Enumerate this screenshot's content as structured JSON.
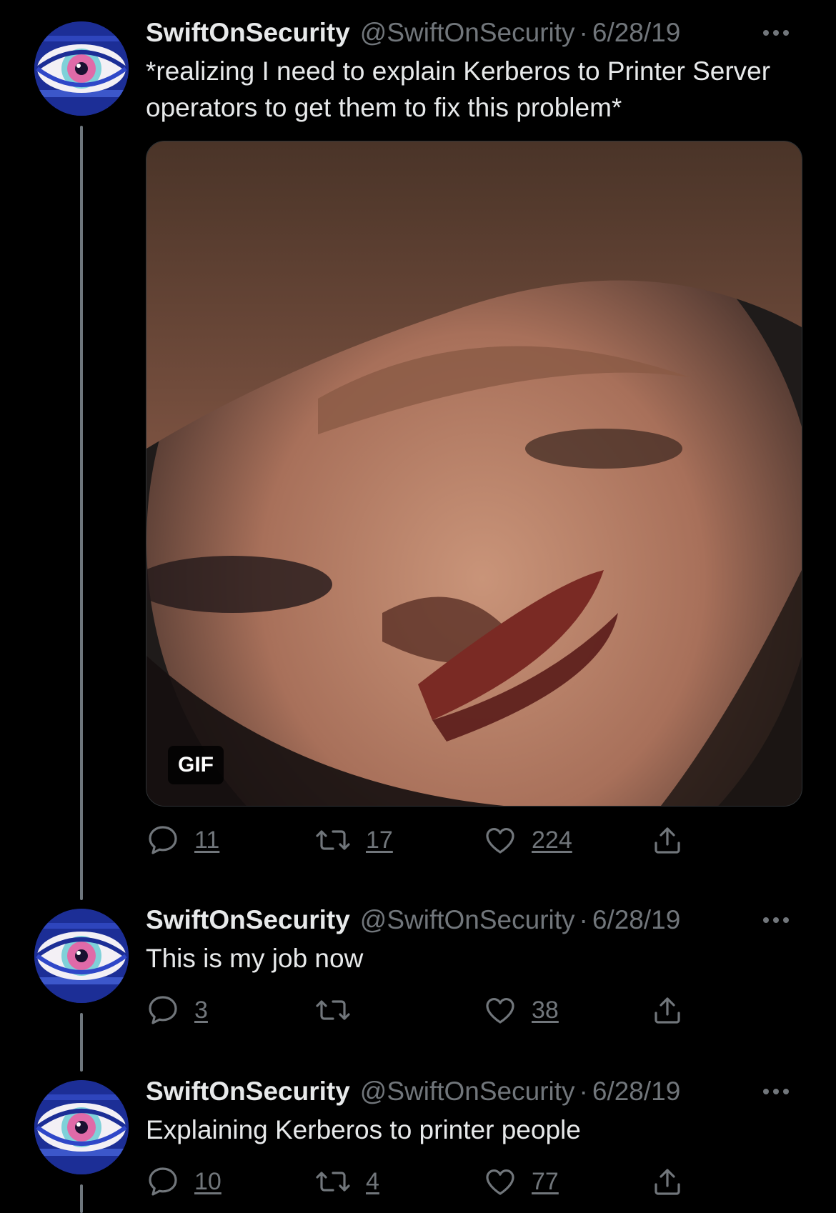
{
  "tweets": [
    {
      "name": "SwiftOnSecurity",
      "handle": "@SwiftOnSecurity",
      "separator": "·",
      "date": "6/28/19",
      "text": "*realizing I need to explain Kerberos to Printer Server operators to get them to fix this problem*",
      "media_badge": "GIF",
      "reply_count": "11",
      "retweet_count": "17",
      "like_count": "224"
    },
    {
      "name": "SwiftOnSecurity",
      "handle": "@SwiftOnSecurity",
      "separator": "·",
      "date": "6/28/19",
      "text": "This is my job now",
      "reply_count": "3",
      "retweet_count": "",
      "like_count": "38"
    },
    {
      "name": "SwiftOnSecurity",
      "handle": "@SwiftOnSecurity",
      "separator": "·",
      "date": "6/28/19",
      "text": "Explaining Kerberos to printer people",
      "reply_count": "10",
      "retweet_count": "4",
      "like_count": "77"
    }
  ],
  "icons": {
    "reply": "reply-icon",
    "retweet": "retweet-icon",
    "like": "heart-icon",
    "share": "share-icon",
    "more": "more-icon"
  },
  "colors": {
    "background": "#000000",
    "primary_text": "#e7e9ea",
    "secondary_text": "#71767b",
    "thread_line": "#6e767d"
  }
}
